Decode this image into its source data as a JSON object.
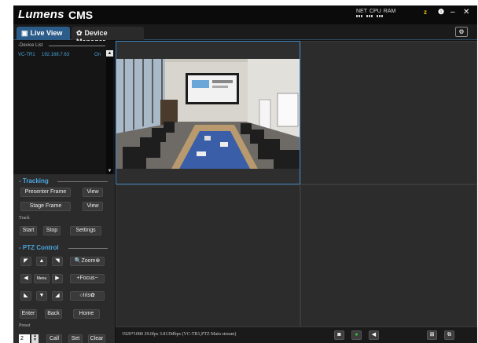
{
  "app": {
    "brand": "Lumens",
    "product": "CMS",
    "meters": [
      "NET",
      "CPU",
      "RAM"
    ],
    "window_controls": {
      "z": "z",
      "info": "❶",
      "minimize": "–",
      "close": "✕"
    }
  },
  "tabs": [
    {
      "label": "Live View",
      "icon": "monitor-icon",
      "active": true
    },
    {
      "label": "Device Manager",
      "icon": "gear-icon",
      "active": false
    }
  ],
  "device_list": {
    "header": "-Device List",
    "devices": [
      {
        "name": "VC-TR1",
        "ip": "192.168.7.63",
        "status": "On"
      }
    ]
  },
  "tracking": {
    "title": "- Tracking",
    "presenter_frame": "Presenter Frame",
    "stage_frame": "Stage Frame",
    "view_label": "View",
    "track_label": "Track",
    "start": "Start",
    "stop": "Stop",
    "settings": "Settings"
  },
  "ptz": {
    "title": "- PTZ Control",
    "zoom": "Zoom",
    "focus": "Focus",
    "iris": "Iris",
    "menu": "Menu",
    "enter": "Enter",
    "back": "Back",
    "home": "Home",
    "preset_label": "Preset",
    "preset_value": "2",
    "call": "Call",
    "set": "Set",
    "clear": "Clear"
  },
  "status": {
    "stream_info": "1920*1080 29.0fps 3.813Mbps (VC-TR1,PTZ Main stream)"
  },
  "colors": {
    "accent": "#3f84c4",
    "link": "#4aa6e0",
    "record_green": "#37c837"
  }
}
